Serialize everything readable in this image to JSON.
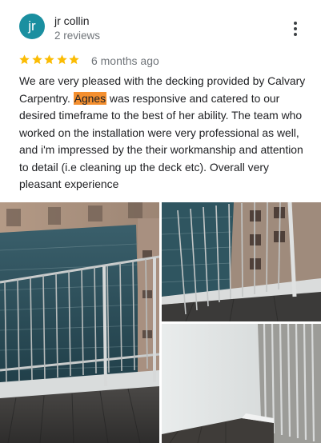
{
  "review": {
    "author": {
      "initials": "jr",
      "name": "jr collin",
      "reviews_count": "2 reviews",
      "avatar_color": "#1a8fa0"
    },
    "rating": 5,
    "rating_max": 5,
    "star_color": "#fbbc04",
    "date": "6 months ago",
    "text": {
      "before": "We are very pleased with the decking provided by Calvary Carpentry. ",
      "highlight": "Agnes",
      "after": " was responsive and catered to our desired timeframe to the best of her ability. The team who worked on the installation were very professional as well, and i'm impressed by the their workmanship and attention to detail (i.e cleaning up the deck etc). Overall very pleasant experience"
    },
    "highlight_color": "#f48f2f",
    "more_icon": "more-vert-icon",
    "photos": [
      {
        "name": "review-photo-balcony-railing",
        "icon": "photo"
      },
      {
        "name": "review-photo-railing-closeup",
        "icon": "photo"
      },
      {
        "name": "review-photo-deck-corner",
        "icon": "photo"
      }
    ]
  }
}
